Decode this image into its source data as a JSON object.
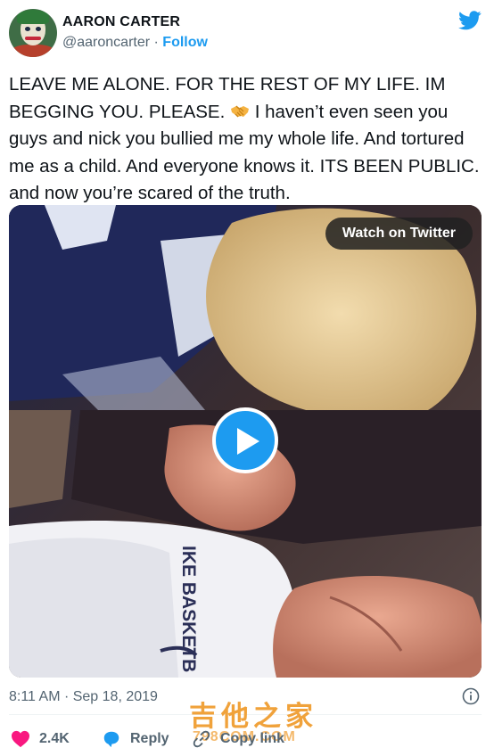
{
  "author": {
    "display_name": "AARON CARTER",
    "handle": "@aaroncarter",
    "separator": "·",
    "follow_label": "Follow"
  },
  "tweet": {
    "text_before_emoji": "LEAVE ME ALONE. FOR THE REST OF MY LIFE. IM BEGGING YOU. PLEASE.",
    "emoji": "handshake-emoji",
    "text_after_emoji": "I haven’t even seen you guys and nick you bullied me my whole life. And tortured me as a child. And everyone knows it. ITS BEEN PUBLIC. and now you’re scared of the truth."
  },
  "media": {
    "watch_label": "Watch on Twitter",
    "play_icon": "play-icon",
    "shirt_text": "IKE BASKETB"
  },
  "meta": {
    "timestamp": "8:11 AM · Sep 18, 2019",
    "info_icon": "info-icon"
  },
  "actions": {
    "like_count": "2.4K",
    "reply_label": "Reply",
    "copy_link_label": "Copy link"
  },
  "watermark": {
    "text": "吉他之家",
    "sub_text": "798COM.COM"
  },
  "colors": {
    "accent": "#1d9bf0",
    "like": "#f91880",
    "secondary_text": "#536471",
    "watermark": "#f0a23b"
  }
}
